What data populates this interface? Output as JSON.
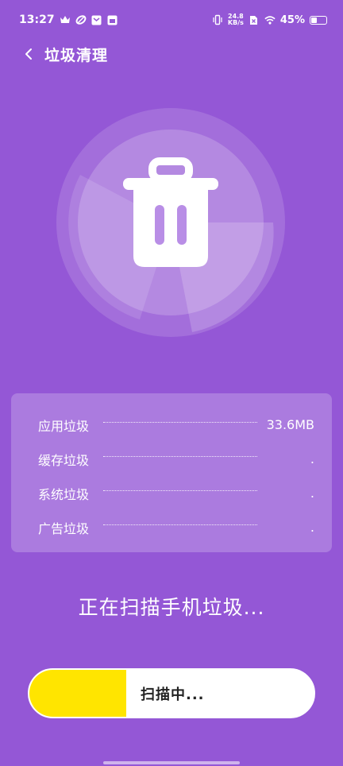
{
  "status_bar": {
    "time": "13:27",
    "net_speed_value": "24.8",
    "net_speed_unit": "KB/s",
    "battery_percent": "45%",
    "battery_level": 0.45,
    "icons": [
      "crown-icon",
      "leaf-icon",
      "mail-icon",
      "calendar-icon",
      "vibrate-icon",
      "sim-icon",
      "wifi-icon",
      "battery-icon"
    ]
  },
  "header": {
    "title": "垃圾清理"
  },
  "junk_list": [
    {
      "label": "应用垃圾",
      "value": "33.6MB"
    },
    {
      "label": "缓存垃圾",
      "value": "."
    },
    {
      "label": "系统垃圾",
      "value": "."
    },
    {
      "label": "广告垃圾",
      "value": "."
    }
  ],
  "scan_status": "正在扫描手机垃圾...",
  "progress": {
    "label": "扫描中...",
    "fraction": 0.34,
    "fill_color": "#ffe500"
  },
  "colors": {
    "background": "#9457d6",
    "progress_fill": "#ffe500"
  }
}
